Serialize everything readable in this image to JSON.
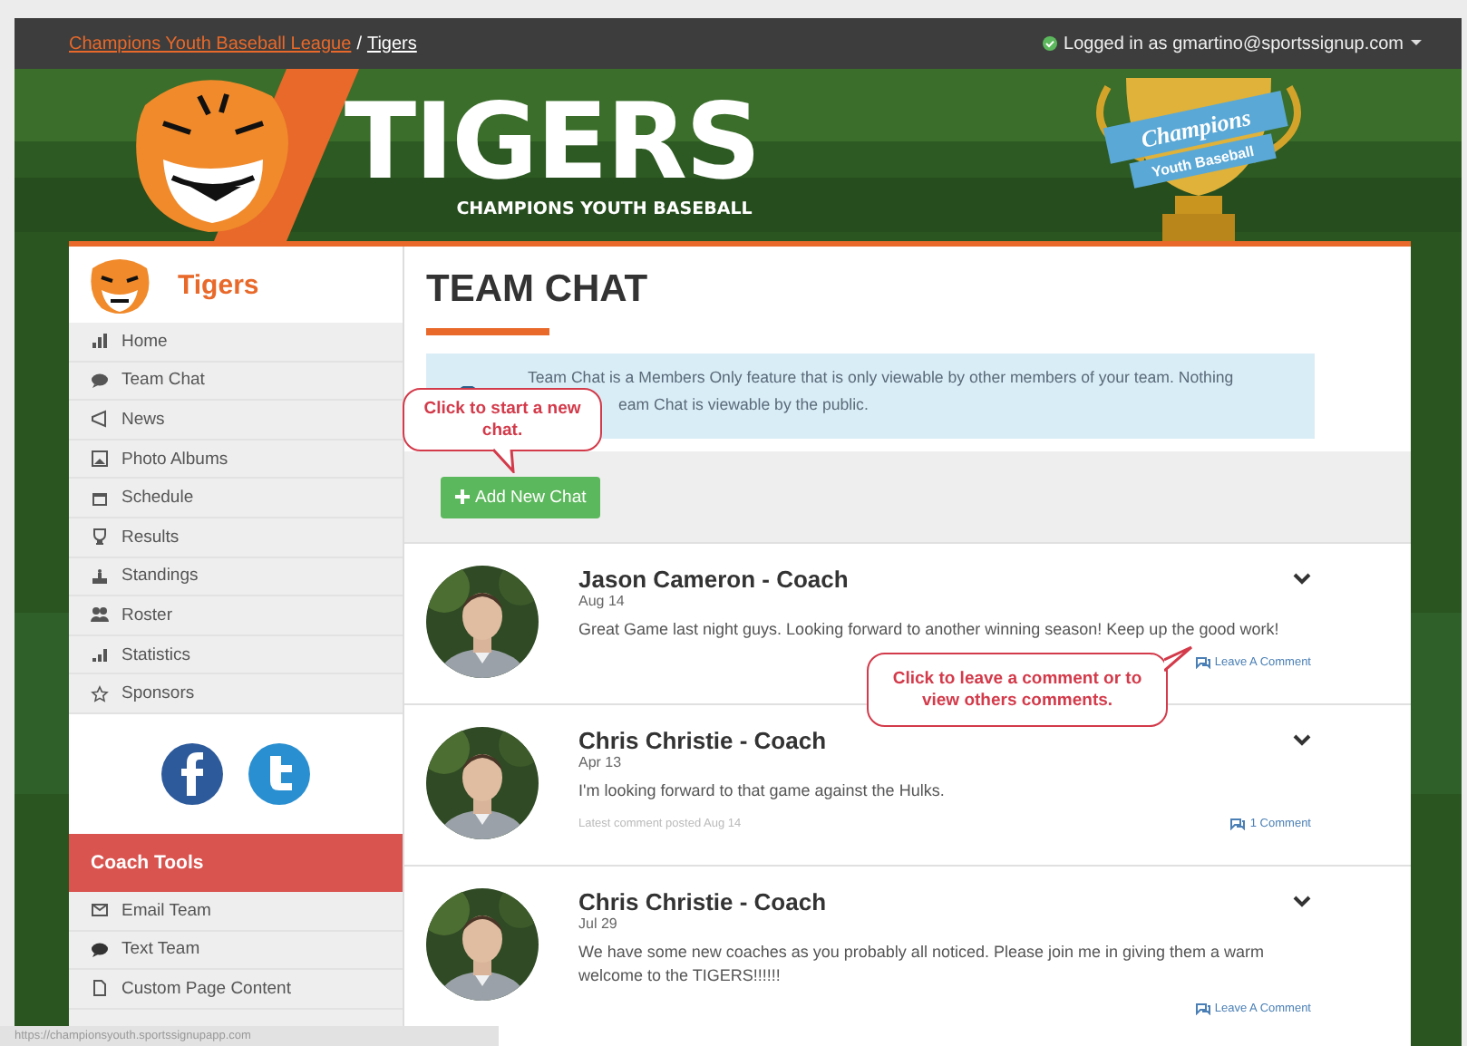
{
  "breadcrumb": {
    "items": [
      {
        "label": "Champions Youth Baseball League"
      },
      {
        "label": "Tigers"
      }
    ],
    "separator": "/"
  },
  "user": {
    "label": "Logged in as gmartino@sportssignup.com"
  },
  "banner": {
    "title": "TIGERS",
    "subtitle": "CHAMPIONS YOUTH BASEBALL",
    "trophy_lines": [
      "Champions",
      "Youth Baseball"
    ]
  },
  "sidebar": {
    "team": "Tigers",
    "items": [
      {
        "label": "Home"
      },
      {
        "label": "Team Chat"
      },
      {
        "label": "News"
      },
      {
        "label": "Photo Albums"
      },
      {
        "label": "Schedule"
      },
      {
        "label": "Results"
      },
      {
        "label": "Standings"
      },
      {
        "label": "Roster"
      },
      {
        "label": "Statistics"
      },
      {
        "label": "Sponsors"
      }
    ]
  },
  "coach_tools": {
    "title": "Coach Tools",
    "items": [
      {
        "label": "Email Team"
      },
      {
        "label": "Text Team"
      },
      {
        "label": "Custom Page Content"
      }
    ]
  },
  "page": {
    "title": "TEAM CHAT",
    "notice_lines": [
      "Team Chat is a Members Only feature that is only viewable by other members of your team. Nothing",
      "eam Chat is viewable by the public."
    ],
    "add_button": "Add New Chat"
  },
  "posts": [
    {
      "author": "Jason Cameron - Coach",
      "date": "Aug 14",
      "message": "Great Game last night guys. Looking forward to another winning season! Keep up the good work!",
      "link": "Leave A Comment"
    },
    {
      "author": "Chris Christie - Coach",
      "date": "Apr 13",
      "message": "I'm looking forward to that game against the Hulks.",
      "note": "Latest comment posted Aug 14",
      "link": "1 Comment"
    },
    {
      "author": "Chris Christie - Coach",
      "date": "Jul 29",
      "message": "We have some new coaches as you probably all noticed. Please join me in giving them a warm welcome to the TIGERS!!!!!!",
      "link": "Leave A Comment"
    }
  ],
  "callouts": [
    {
      "text": "Click to start a new chat."
    },
    {
      "text": "Click to leave a comment or to view others comments."
    }
  ],
  "status_bar": {
    "url": "https://championsyouth.sportssignupapp.com"
  }
}
